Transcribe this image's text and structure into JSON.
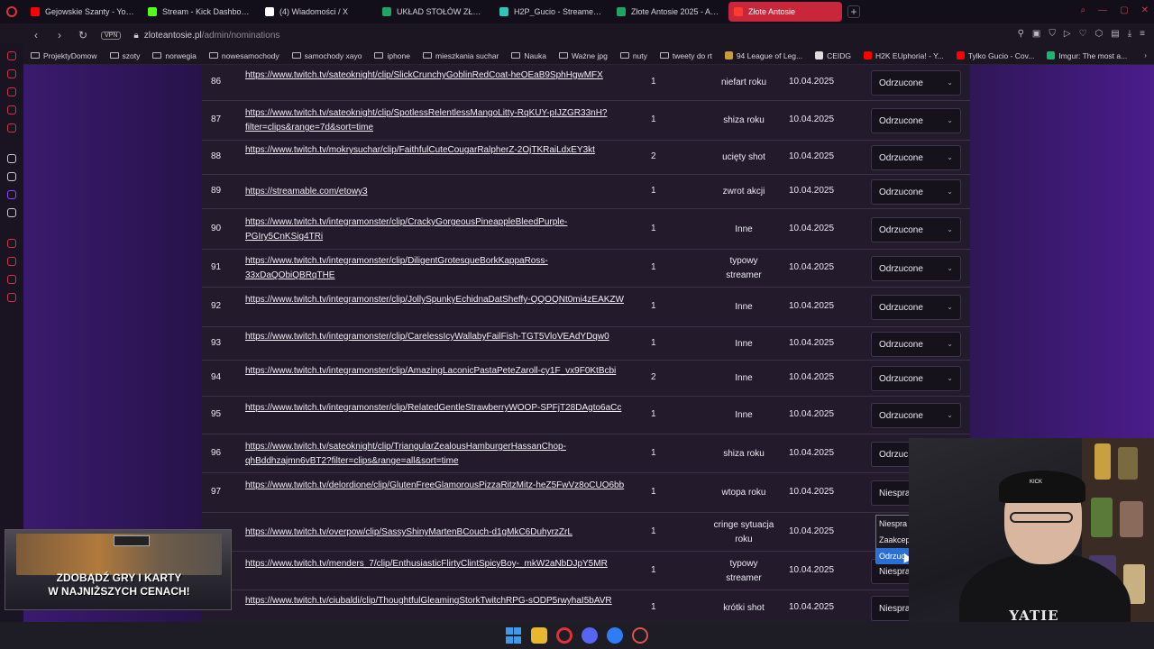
{
  "browser": {
    "tabs": [
      {
        "label": "Gejowskie Szanty - YouTu",
        "color": "#ff0000",
        "active": false
      },
      {
        "label": "Stream - Kick Dashboard",
        "color": "#53fc18",
        "active": false
      },
      {
        "label": "(4) Wiadomości / X",
        "color": "#ffffff",
        "active": false
      },
      {
        "label": "UKŁAD STOŁÓW ZŁOTE",
        "color": "#1fa463",
        "active": false
      },
      {
        "label": "H2P_Gucio - Streamer Ov",
        "color": "#2ec4b6",
        "active": false
      },
      {
        "label": "Złote Antosie 2025 - Arku",
        "color": "#1fa463",
        "active": false
      },
      {
        "label": "Złote Antosie",
        "color": "#ff3b30",
        "active": true
      }
    ],
    "vpn_label": "VPN",
    "url_domain": "zloteantosie.pl",
    "url_path": "/admin/nominations",
    "bookmarks": [
      {
        "label": "ProjektyDomow",
        "icon": "folder-icon"
      },
      {
        "label": "szoty",
        "icon": "folder-icon"
      },
      {
        "label": "norwegia",
        "icon": "folder-icon"
      },
      {
        "label": "nowesamochody",
        "icon": "folder-icon"
      },
      {
        "label": "samochody xayo",
        "icon": "folder-icon"
      },
      {
        "label": "iphone",
        "icon": "folder-icon"
      },
      {
        "label": "mieszkania suchar",
        "icon": "folder-icon"
      },
      {
        "label": "Nauka",
        "icon": "folder-icon"
      },
      {
        "label": "Ważne jpg",
        "icon": "folder-icon"
      },
      {
        "label": "nuty",
        "icon": "folder-icon"
      },
      {
        "label": "tweety do rt",
        "icon": "folder-icon"
      },
      {
        "label": "94 League of Leg...",
        "icon": "league-icon",
        "color": "#c89b3c"
      },
      {
        "label": "CEIDG",
        "icon": "ceidg-icon",
        "color": "#dddddd"
      },
      {
        "label": "H2K EUphoria! - Y...",
        "icon": "youtube-icon",
        "color": "#ff0000"
      },
      {
        "label": "Tylko Gucio - Cov...",
        "icon": "youtube-icon",
        "color": "#ff0000"
      },
      {
        "label": "Imgur: The most a...",
        "icon": "imgur-icon",
        "color": "#1bb76e"
      }
    ]
  },
  "nominations": [
    {
      "id": "86",
      "link": "https://www.twitch.tv/sateoknight/clip/SlickCrunchyGoblinRedCoat-heOEaB9SphHgwMFX",
      "votes": "1",
      "category": "niefart roku",
      "date": "10.04.2025",
      "status": "Odrzucone"
    },
    {
      "id": "87",
      "link": "https://www.twitch.tv/sateoknight/clip/SpotlessRelentlessMangoLitty-RqKUY-pIJZGR33nH?filter=clips&range=7d&sort=time",
      "votes": "1",
      "category": "shiza roku",
      "date": "10.04.2025",
      "status": "Odrzucone"
    },
    {
      "id": "88",
      "link": "https://www.twitch.tv/mokrysuchar/clip/FaithfulCuteCougarRalpherZ-2OjTKRaiLdxEY3kt",
      "votes": "2",
      "category": "ucięty shot",
      "date": "10.04.2025",
      "status": "Odrzucone"
    },
    {
      "id": "89",
      "link": "https://streamable.com/etowy3",
      "votes": "1",
      "category": "zwrot akcji",
      "date": "10.04.2025",
      "status": "Odrzucone"
    },
    {
      "id": "90",
      "link": "https://www.twitch.tv/integramonster/clip/CrackyGorgeousPineappleBleedPurple-PGIry5CnKSig4TRi",
      "votes": "1",
      "category": "Inne",
      "date": "10.04.2025",
      "status": "Odrzucone"
    },
    {
      "id": "91",
      "link": "https://www.twitch.tv/integramonster/clip/DiligentGrotesqueBorkKappaRoss-33xDaQObiQBRqTHE",
      "votes": "1",
      "category": "typowy streamer",
      "date": "10.04.2025",
      "status": "Odrzucone"
    },
    {
      "id": "92",
      "link": "https://www.twitch.tv/integramonster/clip/JollySpunkyEchidnaDatSheffy-QQOQNt0mi4zEAKZW",
      "votes": "1",
      "category": "Inne",
      "date": "10.04.2025",
      "status": "Odrzucone"
    },
    {
      "id": "93",
      "link": "https://www.twitch.tv/integramonster/clip/CarelessIcyWallabyFailFish-TGT5VloVEAdYDqw0",
      "votes": "1",
      "category": "Inne",
      "date": "10.04.2025",
      "status": "Odrzucone"
    },
    {
      "id": "94",
      "link": "https://www.twitch.tv/integramonster/clip/AmazingLaconicPastaPeteZaroll-cy1F_vx9F0KtBcbi",
      "votes": "2",
      "category": "Inne",
      "date": "10.04.2025",
      "status": "Odrzucone"
    },
    {
      "id": "95",
      "link": "https://www.twitch.tv/integramonster/clip/RelatedGentleStrawberryWOOP-SPFjT28DAgto6aCc",
      "votes": "1",
      "category": "Inne",
      "date": "10.04.2025",
      "status": "Odrzucone"
    },
    {
      "id": "96",
      "link": "https://www.twitch.tv/sateoknight/clip/TriangularZealousHamburgerHassanChop-qhBddhzajmn6vBT2?filter=clips&range=all&sort=time",
      "votes": "1",
      "category": "shiza roku",
      "date": "10.04.2025",
      "status": "Odrzuc"
    },
    {
      "id": "97",
      "link": "https://www.twitch.tv/delordione/clip/GlutenFreeGlamorousPizzaRitzMitz-heZ5FwVz8oCUO6bb",
      "votes": "1",
      "category": "wtopa roku",
      "date": "10.04.2025",
      "status": "Niespra"
    },
    {
      "id": "",
      "link": "https://www.twitch.tv/overpow/clip/SassyShinyMartenBCouch-d1gMkC6DuhyrzZrL",
      "votes": "1",
      "category": "cringe sytuacja roku",
      "date": "10.04.2025",
      "status": ""
    },
    {
      "id": "",
      "link": "https://www.twitch.tv/menders_7/clip/EnthusiasticFlirtyClintSpicyBoy-_mkW2aNbDJpY5MR",
      "votes": "1",
      "category": "typowy streamer",
      "date": "10.04.2025",
      "status": "Niespra"
    },
    {
      "id": "100",
      "link": "https://www.twitch.tv/ciubaldi/clip/ThoughtfulGleamingStorkTwitchRPG-sODP5rwyhaI5bAVR",
      "votes": "1",
      "category": "krótki shot",
      "date": "10.04.2025",
      "status": "Niespra"
    }
  ],
  "status_dropdown": {
    "options": [
      "Niespra",
      "Zaakcep",
      "Odrzuc"
    ],
    "selected_index": 2
  },
  "ad": {
    "line1": "ZDOBĄDŹ GRY I KARTY",
    "line2": "W NAJNIŻSZYCH CENACH!"
  },
  "webcam": {
    "cap_text": "KICK",
    "shirt_text": "YATIE"
  }
}
